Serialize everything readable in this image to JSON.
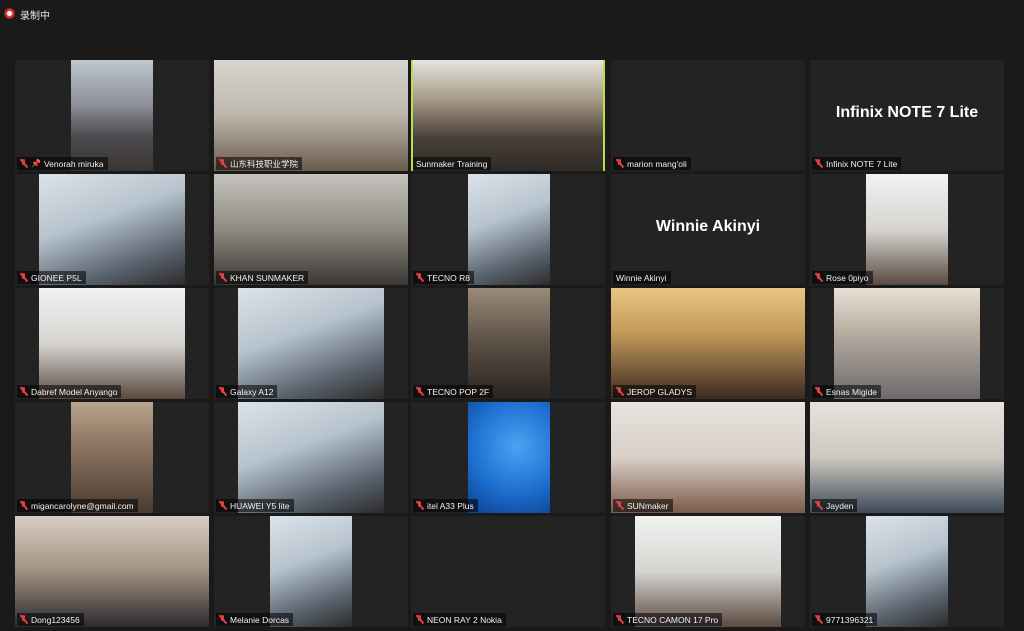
{
  "recording": {
    "label": "录制中",
    "icon": "record-icon"
  },
  "accent": "#b8e04a",
  "tiles": [
    {
      "name": "Venorah miruka",
      "muted": true,
      "pinned": true,
      "video": true
    },
    {
      "name": "山东科技职业学院",
      "muted": true,
      "video": true
    },
    {
      "name": "Sunmaker Training",
      "muted": false,
      "video": true,
      "active_speaker": true
    },
    {
      "name": "marion mang'oli",
      "muted": true,
      "video": false
    },
    {
      "name": "Infinix NOTE 7 Lite",
      "muted": true,
      "video": false,
      "display_name": "Infinix NOTE 7 Lite"
    },
    {
      "name": "GIONEE P5L",
      "muted": true,
      "video": true
    },
    {
      "name": "KHAN SUNMAKER",
      "muted": true,
      "video": true
    },
    {
      "name": "TECNO R8",
      "muted": true,
      "video": true
    },
    {
      "name": "Winnie Akinyi",
      "muted": false,
      "video": false,
      "display_name": "Winnie Akinyi"
    },
    {
      "name": "Rose 0piyo",
      "muted": true,
      "video": true
    },
    {
      "name": "Dabref Model Anyango",
      "muted": true,
      "video": true
    },
    {
      "name": "Galaxy A12",
      "muted": true,
      "video": true
    },
    {
      "name": "TECNO POP 2F",
      "muted": true,
      "video": true
    },
    {
      "name": "JEROP GLADYS",
      "muted": true,
      "video": true
    },
    {
      "name": "Esnas Migide",
      "muted": true,
      "video": true
    },
    {
      "name": "migancarolyne@gmail.com",
      "muted": true,
      "video": true
    },
    {
      "name": "HUAWEI Y5 lite",
      "muted": true,
      "video": true
    },
    {
      "name": "itel A33 Plus",
      "muted": true,
      "video": true
    },
    {
      "name": "SUNmaker",
      "muted": true,
      "video": true
    },
    {
      "name": "Jayden",
      "muted": true,
      "video": true
    },
    {
      "name": "Dong123456",
      "muted": true,
      "video": true
    },
    {
      "name": "Melanie Dorcas",
      "muted": true,
      "video": true
    },
    {
      "name": "NEON RAY 2 Nokia",
      "muted": true,
      "video": false
    },
    {
      "name": "TECNO CAMON 17 Pro",
      "muted": true,
      "video": true
    },
    {
      "name": "9771396321",
      "muted": true,
      "video": true
    }
  ]
}
